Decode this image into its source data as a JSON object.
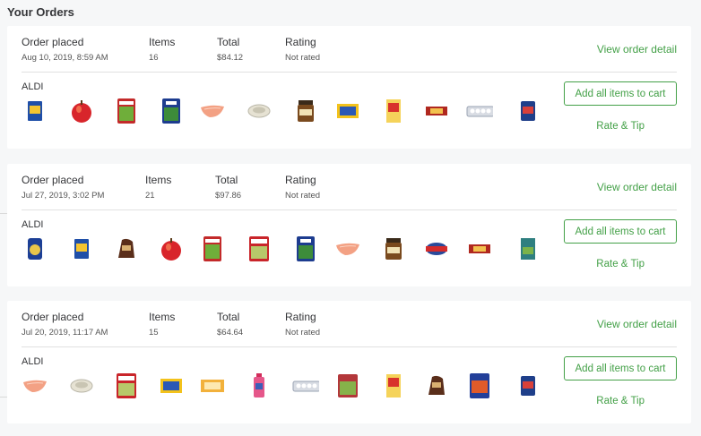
{
  "page": {
    "title": "Your Orders"
  },
  "labels": {
    "order_placed": "Order placed",
    "items": "Items",
    "total": "Total",
    "rating": "Rating",
    "view_detail": "View order detail",
    "add_all": "Add all items to cart",
    "rate_tip": "Rate & Tip"
  },
  "orders": [
    {
      "date": "Aug 10, 2019, 8:59 AM",
      "items": "16",
      "total": "$84.12",
      "rating": "Not rated",
      "store": "ALDI",
      "thumbnails": [
        "macaroni-box",
        "apple",
        "salad-bag",
        "spinach-bag",
        "salmon-fillet",
        "tortilla-bowl",
        "peanut-butter-jar",
        "snack-pack",
        "cereal-box",
        "granola-bar",
        "egg-carton",
        "canned-soup"
      ]
    },
    {
      "date": "Jul 27, 2019, 3:02 PM",
      "items": "21",
      "total": "$97.86",
      "rating": "Not rated",
      "store": "ALDI",
      "thumbnails": [
        "coffee-canister",
        "macaroni-box",
        "bread-loaf",
        "apple",
        "salad-bag",
        "caesar-salad-bag",
        "spinach-bag",
        "salmon-fillet",
        "peanut-butter-jar",
        "tuna-can",
        "granola-bar",
        "seasoning-box"
      ]
    },
    {
      "date": "Jul 20, 2019, 11:17 AM",
      "items": "15",
      "total": "$64.64",
      "rating": "Not rated",
      "store": "ALDI",
      "thumbnails": [
        "salmon-fillet",
        "tortilla-bowl",
        "caesar-salad-bag",
        "snack-pack",
        "cheese-slices",
        "juice-bottle",
        "egg-carton",
        "salad-kit",
        "cereal-box",
        "bread-loaf",
        "pasta-bag",
        "canned-soup"
      ]
    }
  ]
}
